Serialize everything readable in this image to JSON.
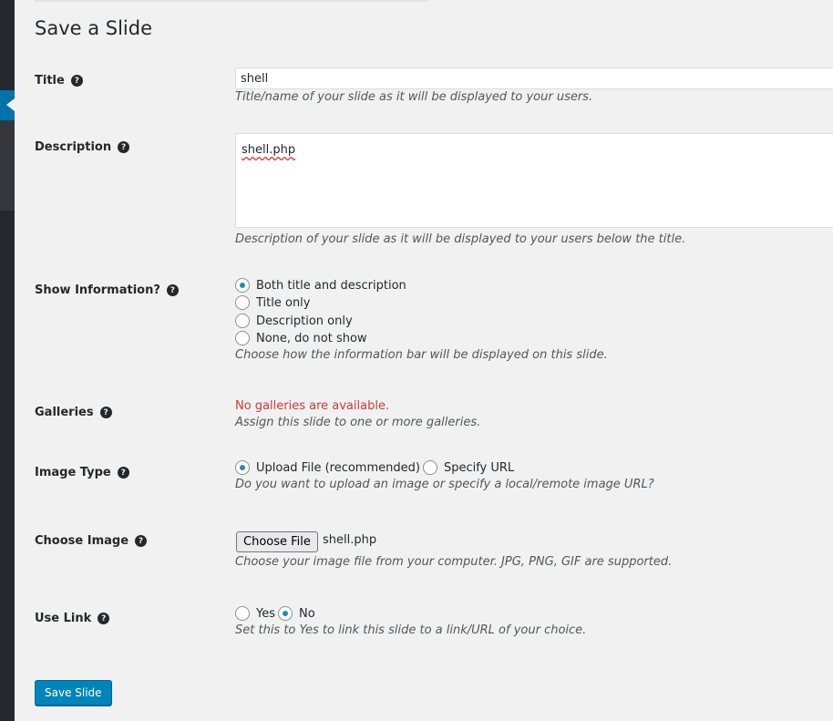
{
  "page": {
    "heading": "Save a Slide"
  },
  "title_field": {
    "label": "Title",
    "value": "shell",
    "hint": "Title/name of your slide as it will be displayed to your users."
  },
  "description_field": {
    "label": "Description",
    "value": "shell.php",
    "hint": "Description of your slide as it will be displayed to your users below the title."
  },
  "show_info": {
    "label": "Show Information?",
    "options": [
      "Both title and description",
      "Title only",
      "Description only",
      "None, do not show"
    ],
    "selected": "Both title and description",
    "hint": "Choose how the information bar will be displayed on this slide."
  },
  "galleries": {
    "label": "Galleries",
    "error": "No galleries are available.",
    "hint": "Assign this slide to one or more galleries."
  },
  "image_type": {
    "label": "Image Type",
    "options": [
      "Upload File (recommended)",
      "Specify URL"
    ],
    "selected": "Upload File (recommended)",
    "hint": "Do you want to upload an image or specify a local/remote image URL?"
  },
  "choose_image": {
    "label": "Choose Image",
    "button_label": "Choose File",
    "file_name": "shell.php",
    "hint": "Choose your image file from your computer. JPG, PNG, GIF are supported."
  },
  "use_link": {
    "label": "Use Link",
    "options": [
      "Yes",
      "No"
    ],
    "selected": "No",
    "hint": "Set this to Yes to link this slide to a link/URL of your choice."
  },
  "submit": {
    "label": "Save Slide"
  },
  "help_glyph": "?",
  "icons": {
    "help": "help-circle-icon",
    "menu_arrow": "active-menu-arrow-icon"
  },
  "colors": {
    "accent": "#0073aa",
    "button": "#0085ba",
    "error": "#d63638",
    "radio_dot": "#1e8cbe"
  }
}
